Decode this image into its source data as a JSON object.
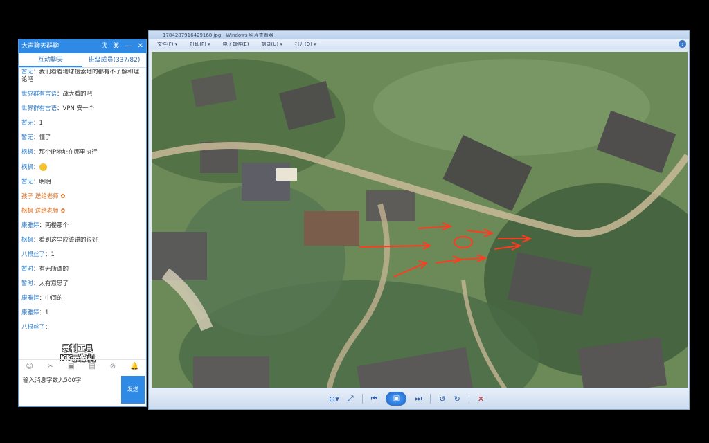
{
  "chat_panel": {
    "title": "大声聊天群聊",
    "controls": [
      "ℛ",
      "⌘",
      "—",
      "✕"
    ],
    "tabs": [
      {
        "label": "互动聊天",
        "active": true
      },
      {
        "label": "班级成员(337/82)",
        "active": false
      }
    ],
    "messages": [
      {
        "name": "暂无",
        "text": "：我们看看地球搜索地的都有不了解和理论吧"
      },
      {
        "name": "世界群有言语",
        "text": "：战大看的吧"
      },
      {
        "name": "世界群有言语",
        "text": "：VPN 安一个"
      },
      {
        "name": "暂无",
        "text": "：1"
      },
      {
        "name": "暂无",
        "text": "：懂了"
      },
      {
        "name": "枫枫",
        "text": "：那个IP地址在哪里执行"
      },
      {
        "name": "枫枫",
        "text": "：",
        "emoji": true
      },
      {
        "name": "暂无",
        "text": "：明明"
      },
      {
        "name": "孩子 送给老师",
        "text": "",
        "orange": true,
        "flower": true
      },
      {
        "name": "枫枫 送给老师",
        "text": "",
        "orange": true,
        "flower": true
      },
      {
        "name": "康雅婷",
        "text": "：两楼那个"
      },
      {
        "name": "枫枫",
        "text": "：看到这里应该讲的很好"
      },
      {
        "name": "八根丝了",
        "text": "：1"
      },
      {
        "name": "暂时",
        "text": "：有无所谓的"
      },
      {
        "name": "暂时",
        "text": "：太有意思了"
      },
      {
        "name": "康雅婷",
        "text": "：中间的"
      },
      {
        "name": "康雅婷",
        "text": "：1"
      },
      {
        "name": "八根丝了",
        "text": "："
      }
    ],
    "watermark_line1": "录制工具",
    "watermark_line2": "KK录像机",
    "toolbar_icons": [
      "smile-icon",
      "scissors-icon",
      "image-icon",
      "doc-icon",
      "ban-icon",
      "bell-icon"
    ],
    "input_value": "输入消息字数入500字",
    "send_label": "发送"
  },
  "viewer": {
    "title": "1784287916429168.jpg - Windows 照片查看器",
    "menu": [
      "文件(F) ▾",
      "打印(P) ▾",
      "电子邮件(E)",
      "刻录(U) ▾",
      "打开(O) ▾"
    ],
    "help": "?",
    "nav": {
      "zoom": "⊕▾",
      "fit": "⤢",
      "prev": "⏮",
      "slideshow": "▣",
      "next": "⏭",
      "rotate_ccw": "↺",
      "rotate_cw": "↻",
      "delete": "✕"
    }
  },
  "colors": {
    "chat_blue": "#2f8ae5",
    "annotation_red": "#ff3b1f",
    "viewer_frame": "#dfe8f5"
  }
}
